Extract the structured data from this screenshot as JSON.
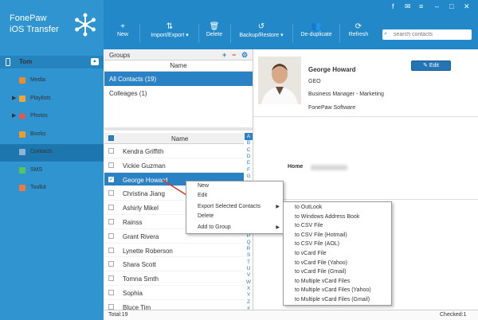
{
  "app": {
    "brand_line1": "FonePaw",
    "brand_line2": "iOS Transfer"
  },
  "device": {
    "name": "Tom"
  },
  "sidebar": {
    "items": [
      {
        "label": "Media",
        "color": "#f28a2a"
      },
      {
        "label": "Playlists",
        "color": "#f0a53a"
      },
      {
        "label": "Photos",
        "color": "#e4574b"
      },
      {
        "label": "Books",
        "color": "#f29b2b"
      },
      {
        "label": "Contacts",
        "color": "#8fb3d2"
      },
      {
        "label": "SMS",
        "color": "#58c35b"
      },
      {
        "label": "Toolkit",
        "color": "#ef7a3c"
      }
    ]
  },
  "toolbar": {
    "new": "New",
    "import_export": "Import/Export",
    "delete": "Delete",
    "backup_restore": "Backup/Restore",
    "deduplicate": "De-duplicate",
    "refresh": "Refresh",
    "search_placeholder": "search contacts"
  },
  "groups": {
    "title": "Groups",
    "column": "Name",
    "items": [
      "All Contacts  (19)",
      "Colleages  (1)"
    ]
  },
  "contacts": {
    "column": "Name",
    "rows": [
      "Kendra Griffith",
      "Vickie Guzman",
      "George Howard",
      "Christina Jiang",
      "Ashirly Mikel",
      "Rainss",
      "Grant Rivera",
      "Lynette Roberson",
      "Shara Scott",
      "Tomna Smth",
      "Sophia",
      "Bluce Tim"
    ]
  },
  "alphabet": [
    "A",
    "B",
    "C",
    "D",
    "E",
    "F",
    "G",
    "H",
    "I",
    "J",
    "K",
    "L",
    "M",
    "N",
    "O",
    "P",
    "Q",
    "R",
    "S",
    "T",
    "U",
    "V",
    "W",
    "X",
    "Y",
    "Z",
    "#"
  ],
  "detail": {
    "name": "George Howard",
    "line1": "GEO",
    "line2": "Business Manager - Marketing",
    "line3": "FonePaw Software",
    "edit": "Edit",
    "home_label": "Home"
  },
  "context_menu": {
    "items": [
      "New",
      "Edit",
      "Export Selected Contacts",
      "Delete",
      "Add to Group"
    ]
  },
  "export_menu": {
    "items": [
      "to OutLook",
      "to Windows Address Book",
      "to CSV File",
      "to CSV File (Hotmail)",
      "to CSV File (AOL)",
      "to vCard File",
      "to vCard File (Yahoo)",
      "to vCard File (Gmail)",
      "to Multiple vCard Files",
      "to Multiple vCard Files (Yahoo)",
      "to Multiple vCard Files (Gmail)"
    ]
  },
  "status": {
    "total": "Total:19",
    "checked": "Checked:1"
  },
  "colors": {
    "sidebar": "#2f94d0",
    "toolbar": "#2288c8",
    "selection": "#2a82c4",
    "arrow": "#d9322b"
  }
}
